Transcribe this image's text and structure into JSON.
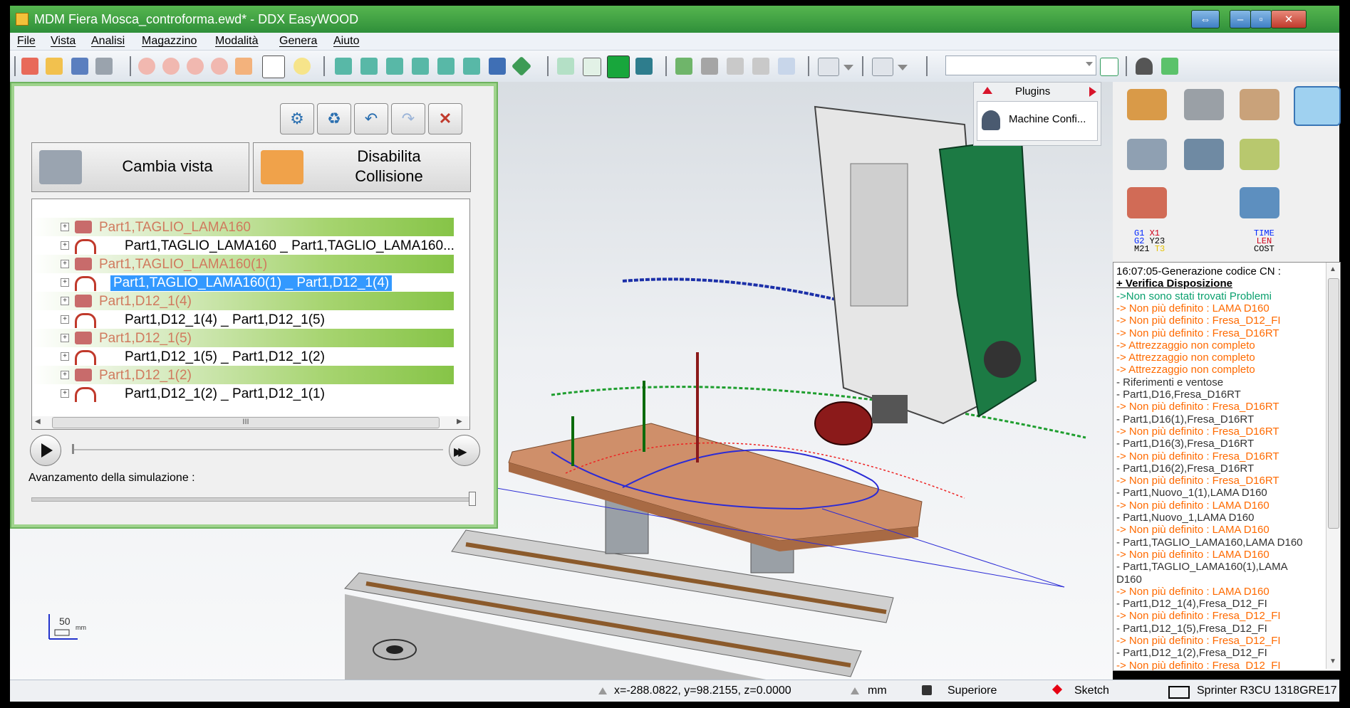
{
  "window": {
    "title": "MDM Fiera Mosca_controforma.ewd* - DDX EasyWOOD"
  },
  "menu": [
    "File",
    "Vista",
    "Analisi",
    "Magazzino",
    "Modalità",
    "Genera",
    "Aiuto"
  ],
  "sim_panel": {
    "cambia_vista": "Cambia vista",
    "disabilita_line1": "Disabilita",
    "disabilita_line2": "Collisione",
    "progress_label": "Avanzamento della simulazione :",
    "progress": 1.0,
    "tree": [
      {
        "type": "op",
        "label": "Part1,TAGLIO_LAMA160"
      },
      {
        "type": "link",
        "label": "Part1,TAGLIO_LAMA160 _ Part1,TAGLIO_LAMA160..."
      },
      {
        "type": "op",
        "label": "Part1,TAGLIO_LAMA160(1)"
      },
      {
        "type": "sel",
        "label": "Part1,TAGLIO_LAMA160(1) _ Part1,D12_1(4)"
      },
      {
        "type": "op",
        "label": "Part1,D12_1(4)"
      },
      {
        "type": "link",
        "label": "Part1,D12_1(4) _ Part1,D12_1(5)"
      },
      {
        "type": "op",
        "label": "Part1,D12_1(5)"
      },
      {
        "type": "link",
        "label": "Part1,D12_1(5) _ Part1,D12_1(2)"
      },
      {
        "type": "op",
        "label": "Part1,D12_1(2)"
      },
      {
        "type": "link",
        "label": "Part1,D12_1(2) _ Part1,D12_1(1)"
      }
    ],
    "hscroll_grip": "III"
  },
  "plugins": {
    "title": "Plugins",
    "item": "Machine Confi..."
  },
  "palette": {
    "gcode": {
      "a1": "G1",
      "a2": "X1",
      "b1": "G2",
      "b2": "Y23",
      "c1": "M21",
      "c2": "T3"
    },
    "stats": {
      "l1": "TIME",
      "l2": "LEN",
      "l3": "COST"
    }
  },
  "log": [
    {
      "c": "#000000",
      "t": "16:07:05-Generazione codice CN :"
    },
    {
      "c": "#000000",
      "t": "+ Verifica Disposizione",
      "b": true
    },
    {
      "c": "#0aa06e",
      "t": "  ->Non sono stati trovati Problemi"
    },
    {
      "c": "#ff6a00",
      "t": "  -> Non più definito : LAMA D160"
    },
    {
      "c": "#ff6a00",
      "t": "  -> Non più definito : Fresa_D12_FI"
    },
    {
      "c": "#ff6a00",
      "t": "  -> Non più definito : Fresa_D16RT"
    },
    {
      "c": "#ff6a00",
      "t": "  -> Attrezzaggio non completo"
    },
    {
      "c": "#ff6a00",
      "t": "  -> Attrezzaggio non completo"
    },
    {
      "c": "#ff6a00",
      "t": "  -> Attrezzaggio non completo"
    },
    {
      "c": "#333333",
      "t": " - Riferimenti e ventose"
    },
    {
      "c": "#333333",
      "t": " - Part1,D16,Fresa_D16RT"
    },
    {
      "c": "#ff6a00",
      "t": "  -> Non più definito : Fresa_D16RT"
    },
    {
      "c": "#333333",
      "t": " - Part1,D16(1),Fresa_D16RT"
    },
    {
      "c": "#ff6a00",
      "t": "  -> Non più definito : Fresa_D16RT"
    },
    {
      "c": "#333333",
      "t": " - Part1,D16(3),Fresa_D16RT"
    },
    {
      "c": "#ff6a00",
      "t": "  -> Non più definito : Fresa_D16RT"
    },
    {
      "c": "#333333",
      "t": " - Part1,D16(2),Fresa_D16RT"
    },
    {
      "c": "#ff6a00",
      "t": "  -> Non più definito : Fresa_D16RT"
    },
    {
      "c": "#333333",
      "t": " - Part1,Nuovo_1(1),LAMA D160"
    },
    {
      "c": "#ff6a00",
      "t": "  -> Non più definito : LAMA D160"
    },
    {
      "c": "#333333",
      "t": " - Part1,Nuovo_1,LAMA D160"
    },
    {
      "c": "#ff6a00",
      "t": "  -> Non più definito : LAMA D160"
    },
    {
      "c": "#333333",
      "t": " - Part1,TAGLIO_LAMA160,LAMA D160"
    },
    {
      "c": "#ff6a00",
      "t": "  -> Non più definito : LAMA D160"
    },
    {
      "c": "#333333",
      "t": " - Part1,TAGLIO_LAMA160(1),LAMA"
    },
    {
      "c": "#333333",
      "t": "   D160"
    },
    {
      "c": "#ff6a00",
      "t": "  -> Non più definito : LAMA D160"
    },
    {
      "c": "#333333",
      "t": " - Part1,D12_1(4),Fresa_D12_FI"
    },
    {
      "c": "#ff6a00",
      "t": "  -> Non più definito : Fresa_D12_FI"
    },
    {
      "c": "#333333",
      "t": " - Part1,D12_1(5),Fresa_D12_FI"
    },
    {
      "c": "#ff6a00",
      "t": "  -> Non più definito : Fresa_D12_FI"
    },
    {
      "c": "#333333",
      "t": " - Part1,D12_1(2),Fresa_D12_FI"
    },
    {
      "c": "#ff6a00",
      "t": "  -> Non più definito : Fresa_D12_FI"
    }
  ],
  "scale": {
    "value": "50",
    "unit": "mm"
  },
  "status": {
    "coords": "x=-288.0822, y=98.2155, z=0.0000",
    "unit": "mm",
    "view": "Superiore",
    "mode": "Sketch",
    "machine": "Sprinter R3CU 1318GRE17"
  }
}
